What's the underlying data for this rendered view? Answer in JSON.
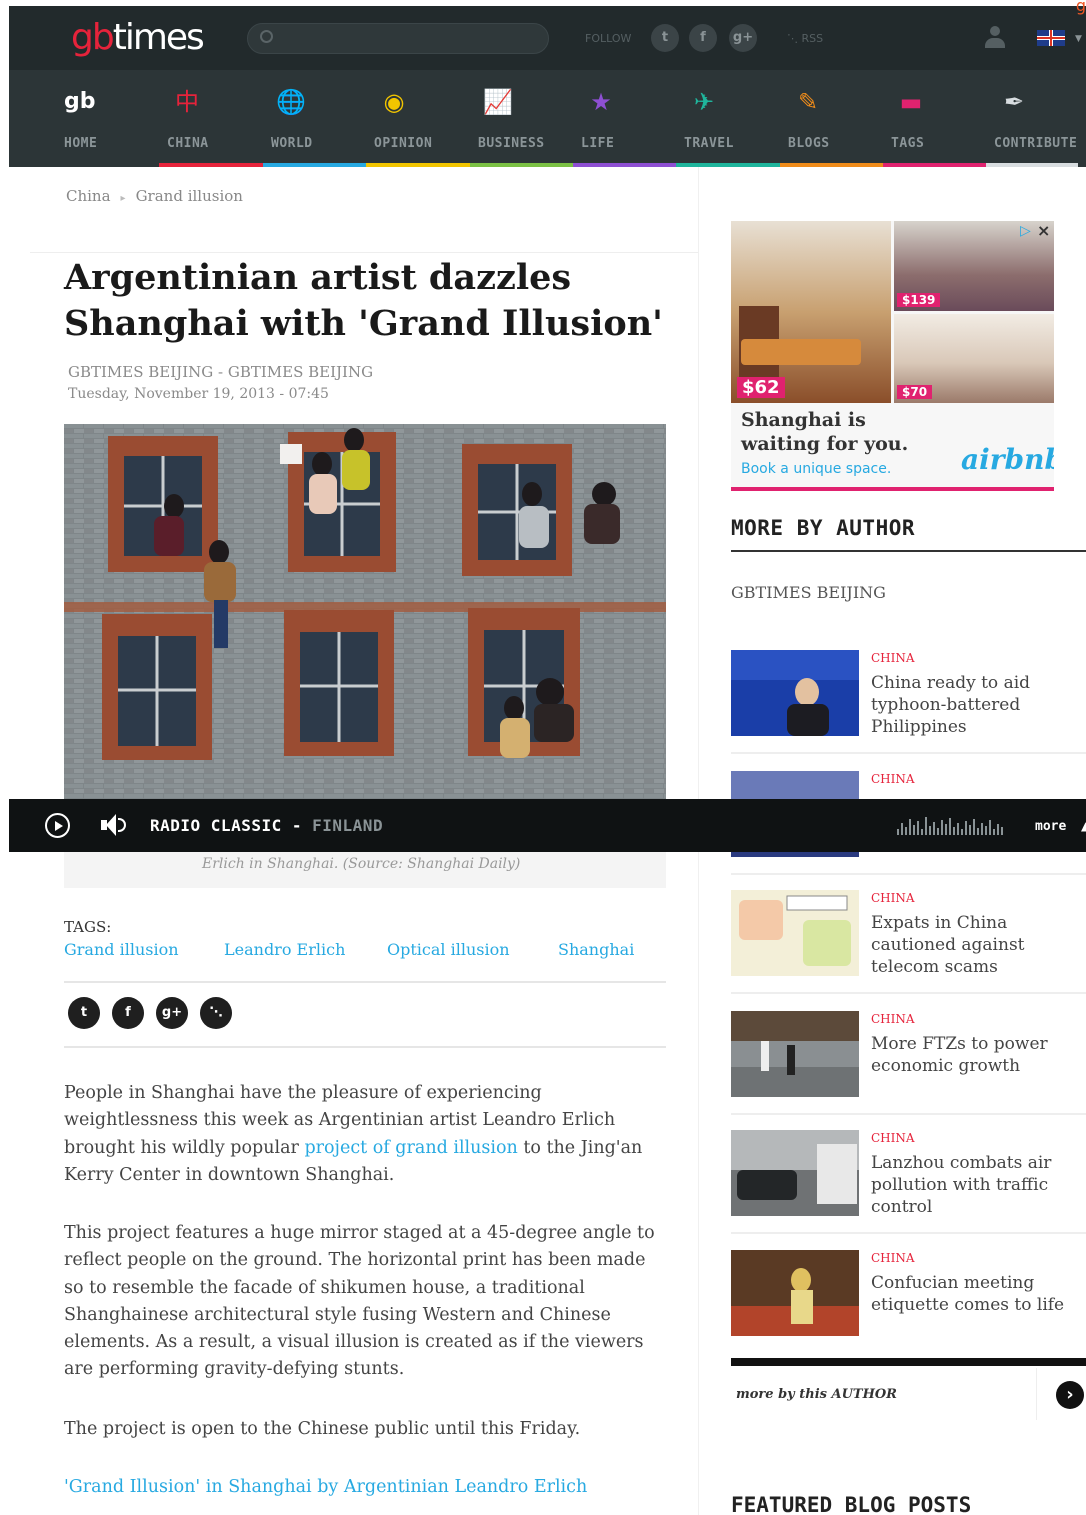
{
  "brand": {
    "gb": "gb",
    "times": "times"
  },
  "search": {
    "placeholder": ""
  },
  "topbar": {
    "follow_label": "FOLLOW",
    "rss_label": "RSS",
    "corner_mark": "g"
  },
  "social": {
    "twitter": "t",
    "facebook": "f",
    "googleplus": "g+"
  },
  "nav": [
    {
      "label": "HOME",
      "icon": "gb",
      "color": "#ffffff",
      "bar": "#2c3537"
    },
    {
      "label": "CHINA",
      "icon": "中",
      "color": "#e6233b",
      "bar": "#e6233b"
    },
    {
      "label": "WORLD",
      "icon": "🌐",
      "color": "#27a9e1",
      "bar": "#27a9e1"
    },
    {
      "label": "OPINION",
      "icon": "◉",
      "color": "#f2c500",
      "bar": "#f2c500"
    },
    {
      "label": "BUSINESS",
      "icon": "📈",
      "color": "#7bc144",
      "bar": "#7bc144"
    },
    {
      "label": "LIFE",
      "icon": "★",
      "color": "#8e4fd3",
      "bar": "#8e4fd3"
    },
    {
      "label": "TRAVEL",
      "icon": "✈",
      "color": "#1fb59c",
      "bar": "#1fb59c"
    },
    {
      "label": "BLOGS",
      "icon": "✎",
      "color": "#f08c1a",
      "bar": "#f08c1a"
    },
    {
      "label": "TAGS",
      "icon": "▬",
      "color": "#e0226f",
      "bar": "#e0226f"
    },
    {
      "label": "CONTRIBUTE",
      "icon": "✒",
      "color": "#d8dde0",
      "bar": "#d8dde0"
    }
  ],
  "breadcrumb": {
    "section": "China",
    "current": "Grand illusion"
  },
  "article": {
    "headline": "Argentinian artist dazzles Shanghai with 'Grand Illusion'",
    "byline": "GBTIMES BEIJING - GBTIMES BEIJING",
    "date": "Tuesday, November 19, 2013 - 07:45",
    "caption": "Erlich in Shanghai. (Source: Shanghai Daily)",
    "tags_label": "TAGS:",
    "tags": [
      "Grand illusion",
      "Leandro Erlich",
      "Optical illusion",
      "Shanghai"
    ],
    "p1_before": "People in Shanghai have the pleasure of experiencing weightlessness this week as Argentinian artist Leandro Erlich brought his wildly popular ",
    "p1_link": "project of grand illusion",
    "p1_after": " to the Jing'an Kerry Center in downtown Shanghai.",
    "p2": "This project features a huge mirror staged at a 45-degree angle to reflect people on the ground. The horizontal print has been made so to resemble the facade of shikumen house, a traditional Shanghainese architectural style fusing Western and Chinese elements. As a result, a visual illusion is created as if the viewers are performing gravity-defying stunts.",
    "p3": "The project is open to the Chinese public until this Friday.",
    "link": "'Grand Illusion' in Shanghai by Argentinian Leandro Erlich"
  },
  "radio": {
    "station": "RADIO CLASSIC",
    "separator": " - ",
    "country": "FINLAND",
    "more": "more"
  },
  "ad": {
    "price1": "$62",
    "price2": "$139",
    "price3": "$70",
    "headline": "Shanghai is waiting for you.",
    "sub": "Book a unique space.",
    "brand": "airbnb"
  },
  "sidebar": {
    "heading": "MORE BY AUTHOR",
    "author": "GBTIMES BEIJING",
    "items": [
      {
        "category": "CHINA",
        "title": "China ready to aid typhoon-battered Philippines"
      },
      {
        "category": "CHINA",
        "title": ""
      },
      {
        "category": "CHINA",
        "title": "Expats in China cautioned against telecom scams"
      },
      {
        "category": "CHINA",
        "title": "More FTZs to power economic growth"
      },
      {
        "category": "CHINA",
        "title": "Lanzhou combats air pollution with traffic control"
      },
      {
        "category": "CHINA",
        "title": "Confucian meeting etiquette comes to life"
      }
    ],
    "more_label": "more by this AUTHOR",
    "next_symbol": "›",
    "featured_heading": "FEATURED BLOG POSTS"
  }
}
